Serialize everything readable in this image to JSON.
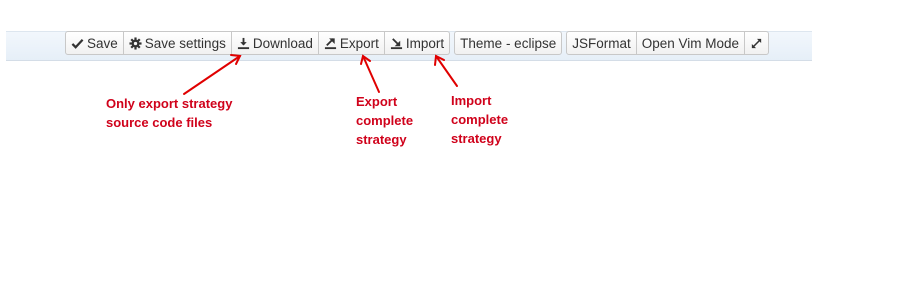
{
  "toolbar": {
    "save": {
      "label": "Save",
      "icon": "check-icon"
    },
    "save_settings": {
      "label": "Save settings",
      "icon": "gear-icon"
    },
    "download": {
      "label": "Download",
      "icon": "download-icon"
    },
    "export": {
      "label": "Export",
      "icon": "export-icon"
    },
    "import": {
      "label": "Import",
      "icon": "import-icon"
    },
    "theme": {
      "label": "Theme - eclipse"
    },
    "jsformat": {
      "label": "JSFormat"
    },
    "vim_mode": {
      "label": "Open Vim Mode"
    },
    "fullscreen": {
      "icon": "expand-icon"
    }
  },
  "annotations": {
    "download_note": {
      "line1": "Only export strategy",
      "line2": "source code files"
    },
    "export_note": {
      "line1": "Export",
      "line2": "complete",
      "line3": "strategy"
    },
    "import_note": {
      "line1": "Import",
      "line2": "complete",
      "line3": "strategy"
    },
    "color": "#d0021b"
  }
}
